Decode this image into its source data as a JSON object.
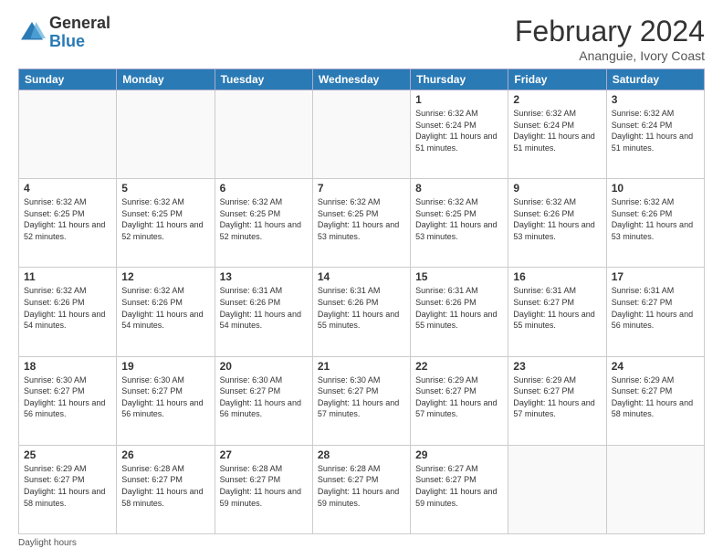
{
  "logo": {
    "general": "General",
    "blue": "Blue"
  },
  "header": {
    "month": "February 2024",
    "location": "Ananguie, Ivory Coast"
  },
  "weekdays": [
    "Sunday",
    "Monday",
    "Tuesday",
    "Wednesday",
    "Thursday",
    "Friday",
    "Saturday"
  ],
  "weeks": [
    [
      {
        "day": "",
        "info": ""
      },
      {
        "day": "",
        "info": ""
      },
      {
        "day": "",
        "info": ""
      },
      {
        "day": "",
        "info": ""
      },
      {
        "day": "1",
        "info": "Sunrise: 6:32 AM\nSunset: 6:24 PM\nDaylight: 11 hours and 51 minutes."
      },
      {
        "day": "2",
        "info": "Sunrise: 6:32 AM\nSunset: 6:24 PM\nDaylight: 11 hours and 51 minutes."
      },
      {
        "day": "3",
        "info": "Sunrise: 6:32 AM\nSunset: 6:24 PM\nDaylight: 11 hours and 51 minutes."
      }
    ],
    [
      {
        "day": "4",
        "info": "Sunrise: 6:32 AM\nSunset: 6:25 PM\nDaylight: 11 hours and 52 minutes."
      },
      {
        "day": "5",
        "info": "Sunrise: 6:32 AM\nSunset: 6:25 PM\nDaylight: 11 hours and 52 minutes."
      },
      {
        "day": "6",
        "info": "Sunrise: 6:32 AM\nSunset: 6:25 PM\nDaylight: 11 hours and 52 minutes."
      },
      {
        "day": "7",
        "info": "Sunrise: 6:32 AM\nSunset: 6:25 PM\nDaylight: 11 hours and 53 minutes."
      },
      {
        "day": "8",
        "info": "Sunrise: 6:32 AM\nSunset: 6:25 PM\nDaylight: 11 hours and 53 minutes."
      },
      {
        "day": "9",
        "info": "Sunrise: 6:32 AM\nSunset: 6:26 PM\nDaylight: 11 hours and 53 minutes."
      },
      {
        "day": "10",
        "info": "Sunrise: 6:32 AM\nSunset: 6:26 PM\nDaylight: 11 hours and 53 minutes."
      }
    ],
    [
      {
        "day": "11",
        "info": "Sunrise: 6:32 AM\nSunset: 6:26 PM\nDaylight: 11 hours and 54 minutes."
      },
      {
        "day": "12",
        "info": "Sunrise: 6:32 AM\nSunset: 6:26 PM\nDaylight: 11 hours and 54 minutes."
      },
      {
        "day": "13",
        "info": "Sunrise: 6:31 AM\nSunset: 6:26 PM\nDaylight: 11 hours and 54 minutes."
      },
      {
        "day": "14",
        "info": "Sunrise: 6:31 AM\nSunset: 6:26 PM\nDaylight: 11 hours and 55 minutes."
      },
      {
        "day": "15",
        "info": "Sunrise: 6:31 AM\nSunset: 6:26 PM\nDaylight: 11 hours and 55 minutes."
      },
      {
        "day": "16",
        "info": "Sunrise: 6:31 AM\nSunset: 6:27 PM\nDaylight: 11 hours and 55 minutes."
      },
      {
        "day": "17",
        "info": "Sunrise: 6:31 AM\nSunset: 6:27 PM\nDaylight: 11 hours and 56 minutes."
      }
    ],
    [
      {
        "day": "18",
        "info": "Sunrise: 6:30 AM\nSunset: 6:27 PM\nDaylight: 11 hours and 56 minutes."
      },
      {
        "day": "19",
        "info": "Sunrise: 6:30 AM\nSunset: 6:27 PM\nDaylight: 11 hours and 56 minutes."
      },
      {
        "day": "20",
        "info": "Sunrise: 6:30 AM\nSunset: 6:27 PM\nDaylight: 11 hours and 56 minutes."
      },
      {
        "day": "21",
        "info": "Sunrise: 6:30 AM\nSunset: 6:27 PM\nDaylight: 11 hours and 57 minutes."
      },
      {
        "day": "22",
        "info": "Sunrise: 6:29 AM\nSunset: 6:27 PM\nDaylight: 11 hours and 57 minutes."
      },
      {
        "day": "23",
        "info": "Sunrise: 6:29 AM\nSunset: 6:27 PM\nDaylight: 11 hours and 57 minutes."
      },
      {
        "day": "24",
        "info": "Sunrise: 6:29 AM\nSunset: 6:27 PM\nDaylight: 11 hours and 58 minutes."
      }
    ],
    [
      {
        "day": "25",
        "info": "Sunrise: 6:29 AM\nSunset: 6:27 PM\nDaylight: 11 hours and 58 minutes."
      },
      {
        "day": "26",
        "info": "Sunrise: 6:28 AM\nSunset: 6:27 PM\nDaylight: 11 hours and 58 minutes."
      },
      {
        "day": "27",
        "info": "Sunrise: 6:28 AM\nSunset: 6:27 PM\nDaylight: 11 hours and 59 minutes."
      },
      {
        "day": "28",
        "info": "Sunrise: 6:28 AM\nSunset: 6:27 PM\nDaylight: 11 hours and 59 minutes."
      },
      {
        "day": "29",
        "info": "Sunrise: 6:27 AM\nSunset: 6:27 PM\nDaylight: 11 hours and 59 minutes."
      },
      {
        "day": "",
        "info": ""
      },
      {
        "day": "",
        "info": ""
      }
    ]
  ],
  "footer": {
    "note": "Daylight hours"
  }
}
